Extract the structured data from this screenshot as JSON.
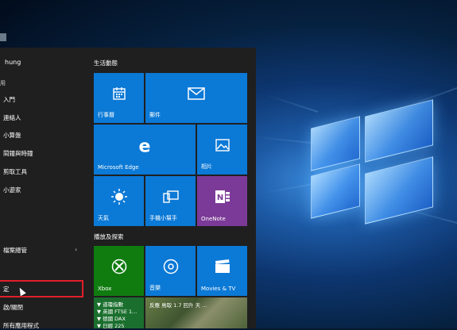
{
  "user": {
    "name": "hung"
  },
  "left_menu": {
    "section_header": "用",
    "apps": [
      "入門",
      "連絡人",
      "小算盤",
      "鬧鐘與時鐘",
      "剪取工具",
      "小遊家"
    ],
    "file_explorer": "檔案總管",
    "settings": "定",
    "power": "啟/關閉",
    "all_apps": "所有應用程式"
  },
  "groups": {
    "life": "生活動態",
    "play": "播放及探索"
  },
  "tiles": {
    "calendar": "行事曆",
    "mail": "郵件",
    "edge": "Microsoft Edge",
    "photos": "相片",
    "weather": "天氣",
    "phone": "手機小幫手",
    "onenote": "OneNote",
    "xbox": "Xbox",
    "groove": "音樂",
    "movies": "Movies & TV"
  },
  "money_tile": {
    "line1": "▼ 道瓊指數",
    "line2": "▼ 英國 FTSE 1...",
    "line3": "▼ 德國 DAX",
    "line4": "▼ 日經 225"
  },
  "news_tile": {
    "headline": "反應 鳥取 1.7 回升 天 ..."
  },
  "colors": {
    "tile_blue": "#0b79d6",
    "xbox_green": "#107c10",
    "onenote_purple": "#7b3a97",
    "highlight_red": "#e21e2a"
  },
  "icons": {
    "calendar": "calendar-icon",
    "mail": "mail-icon",
    "edge": "edge-icon",
    "photos": "photos-icon",
    "weather": "sun-icon",
    "phone": "phone-companion-icon",
    "onenote": "onenote-icon",
    "xbox": "xbox-icon",
    "groove": "groove-music-icon",
    "movies": "clapperboard-icon"
  }
}
